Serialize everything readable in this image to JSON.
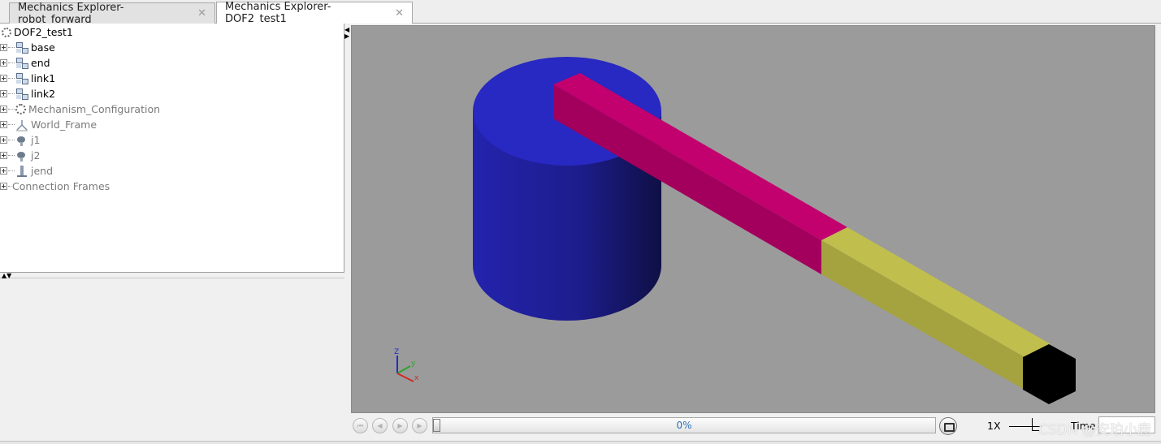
{
  "tabs": [
    {
      "label": "Mechanics Explorer-robot_forward",
      "active": false,
      "close": "✕"
    },
    {
      "label": "Mechanics Explorer-DOF2_test1",
      "active": true,
      "close": "✕"
    }
  ],
  "tree": {
    "root": "DOF2_test1",
    "items": [
      {
        "label": "base",
        "icon": "frame-icon",
        "dim": false
      },
      {
        "label": "end",
        "icon": "frame-icon",
        "dim": false
      },
      {
        "label": "link1",
        "icon": "frame-icon",
        "dim": false
      },
      {
        "label": "link2",
        "icon": "frame-icon",
        "dim": false
      },
      {
        "label": "Mechanism_Configuration",
        "icon": "mechanism-icon",
        "dim": true
      },
      {
        "label": "World_Frame",
        "icon": "world-frame-icon",
        "dim": true
      },
      {
        "label": "j1",
        "icon": "joint-icon",
        "dim": true
      },
      {
        "label": "j2",
        "icon": "joint-icon",
        "dim": true
      },
      {
        "label": "jend",
        "icon": "weld-icon",
        "dim": true
      },
      {
        "label": "Connection Frames",
        "icon": "none",
        "dim": true
      }
    ]
  },
  "viewport": {
    "background": "#9b9b9b",
    "colors": {
      "cylinder": "#2626c0",
      "link1": "#c2006e",
      "link2": "#c0bf4e",
      "end": "#000000"
    },
    "triad": {
      "z": "Z",
      "y": "y",
      "x": "x"
    }
  },
  "playback": {
    "progress_text": "0%",
    "progress": 0,
    "speed": "1X",
    "time_label": "Time"
  },
  "watermark": "CSDN @安珀小鹿"
}
